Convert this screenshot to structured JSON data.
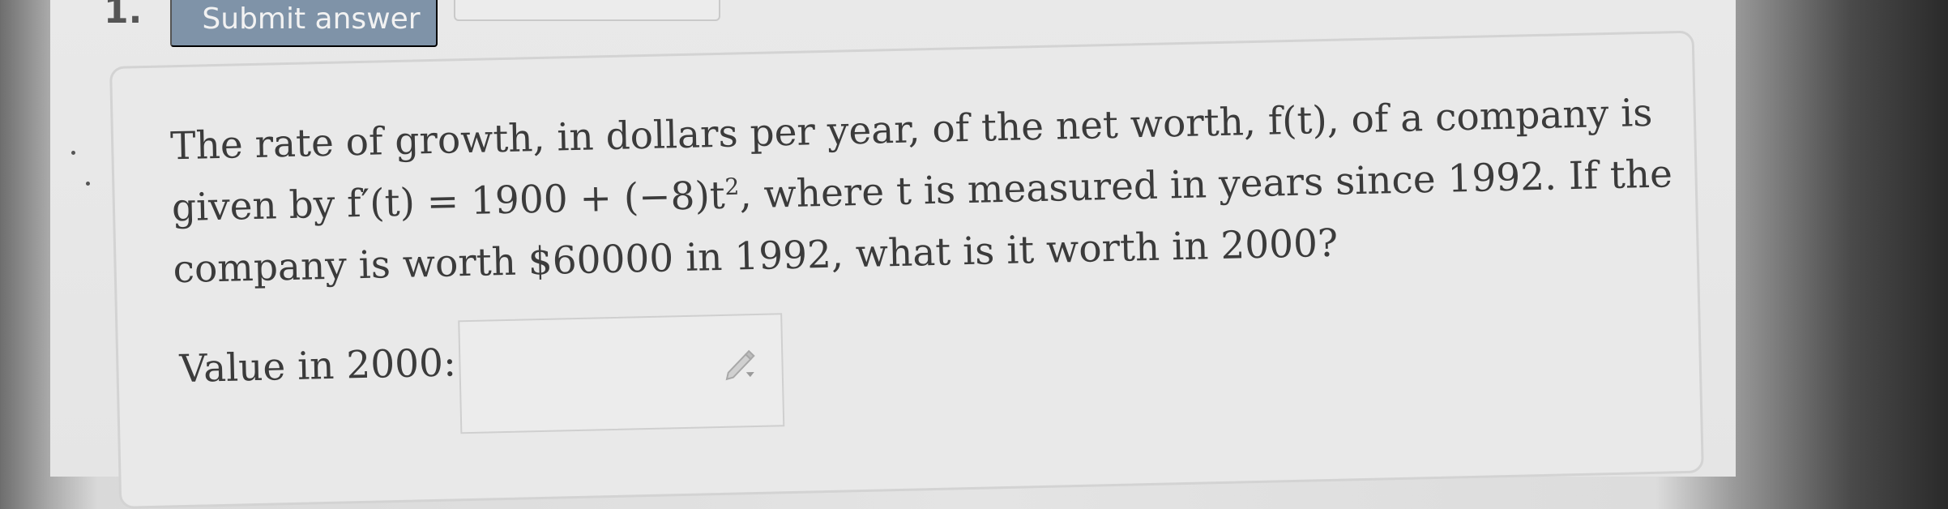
{
  "header": {
    "question_number": "1.",
    "submit_label": "Submit answer"
  },
  "question": {
    "line1": "The rate of growth, in dollars per year, of the net worth, f(t), of a company is",
    "line2_before": "given by f′(t) = 1900 + (−8)t",
    "line2_exp": "2",
    "line2_after": ", where t is measured in years since 1992. If the",
    "line3": "company is worth $60000 in 1992, what is it worth in 2000?"
  },
  "answer": {
    "label": "Value in 2000:",
    "value": "",
    "placeholder": ""
  }
}
